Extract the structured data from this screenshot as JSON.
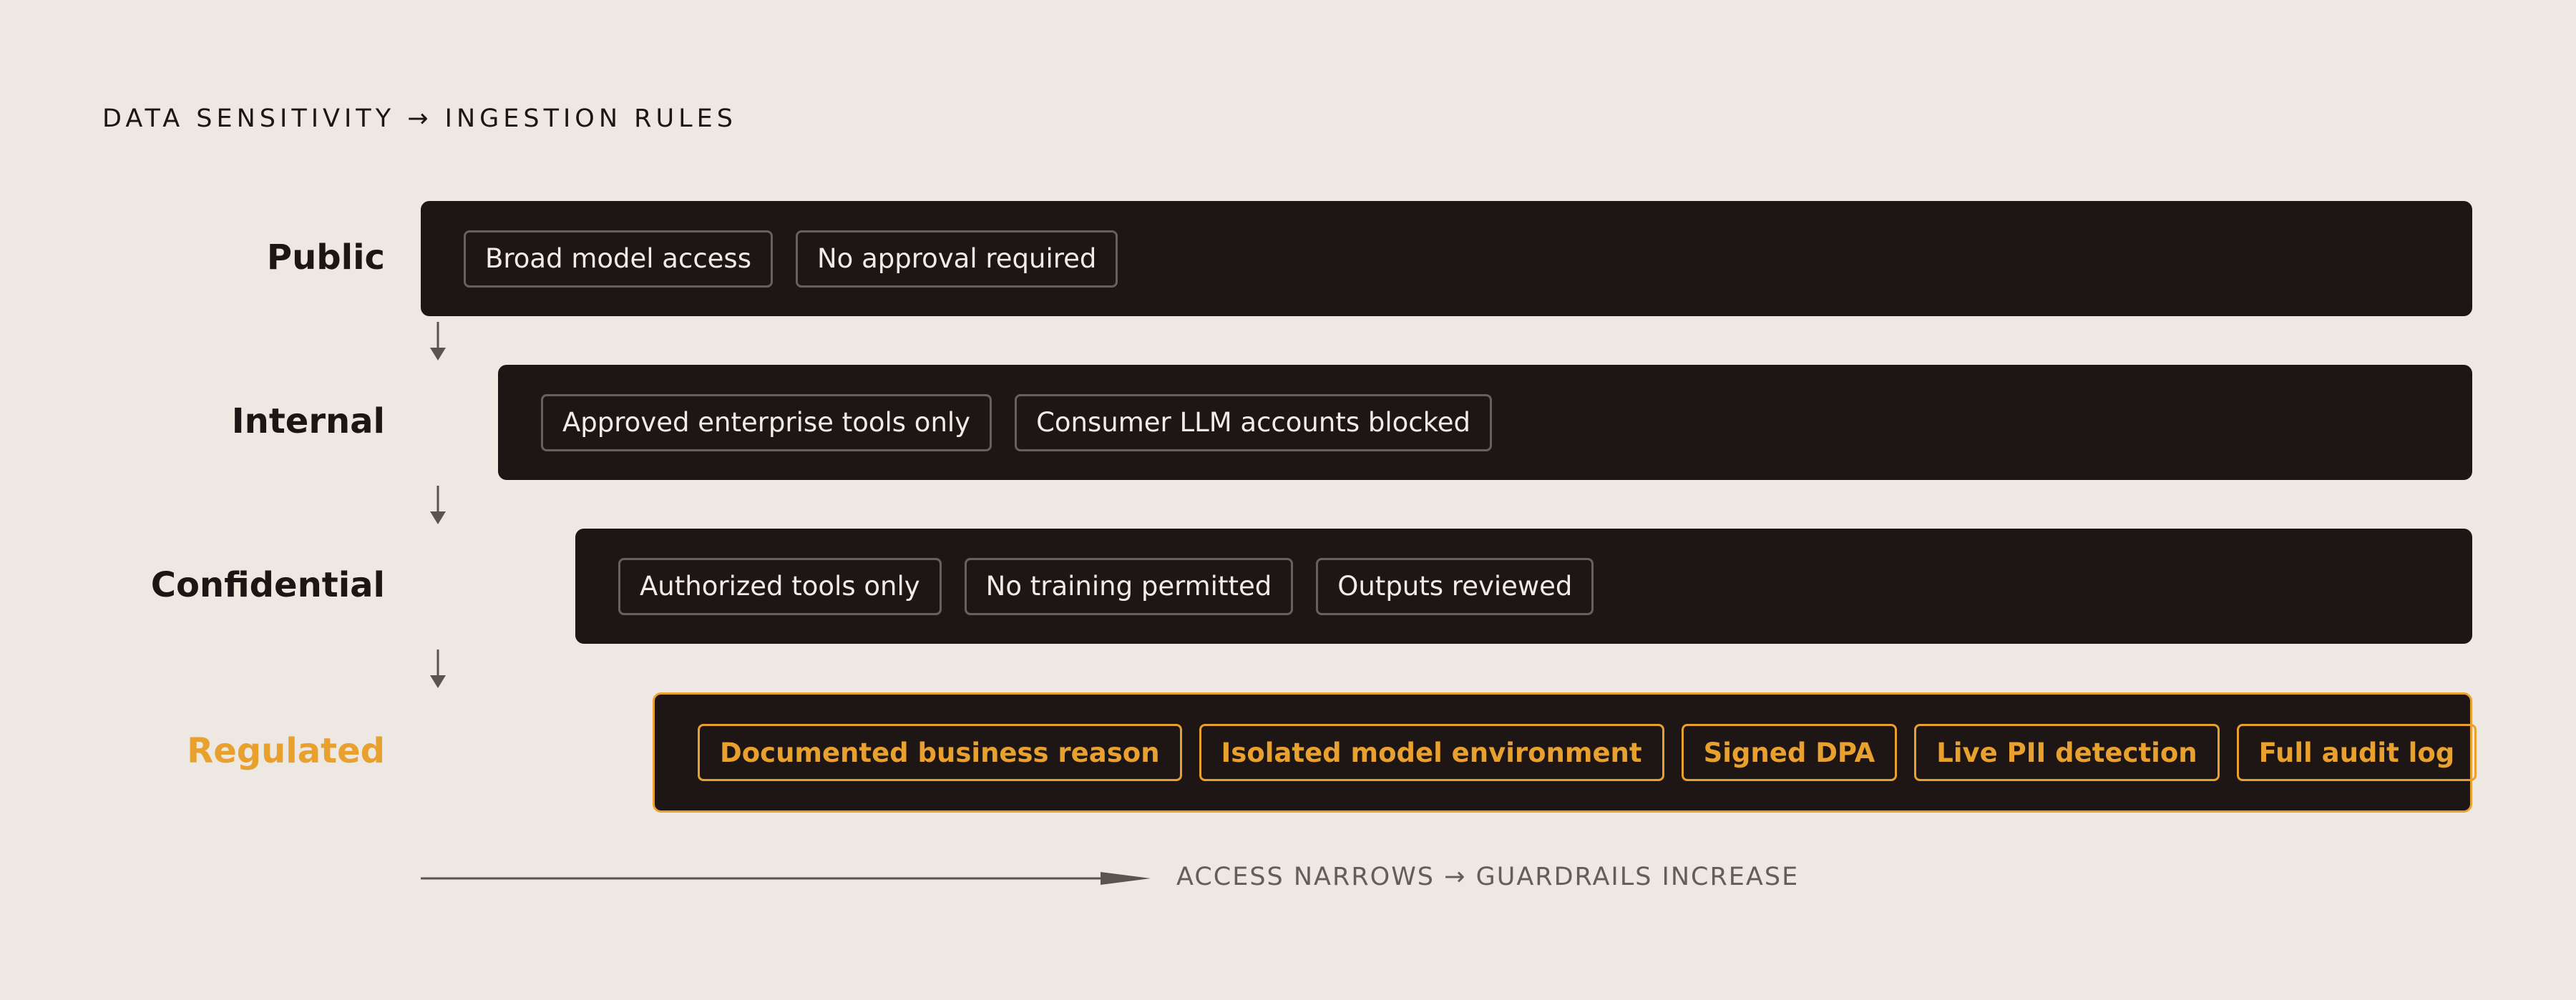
{
  "title": "DATA SENSITIVITY → INGESTION RULES",
  "accent_color": "#e8a02e",
  "tiers": [
    {
      "label": "Public",
      "rules": [
        "Broad model access",
        "No approval required"
      ]
    },
    {
      "label": "Internal",
      "rules": [
        "Approved enterprise tools only",
        "Consumer LLM accounts blocked"
      ]
    },
    {
      "label": "Confidential",
      "rules": [
        "Authorized tools only",
        "No training permitted",
        "Outputs reviewed"
      ]
    },
    {
      "label": "Regulated",
      "rules": [
        "Documented business reason",
        "Isolated model environment",
        "Signed DPA",
        "Live PII detection",
        "Full audit log"
      ]
    }
  ],
  "footer": {
    "text": "ACCESS NARROWS → GUARDRAILS INCREASE"
  },
  "icons": {
    "flow_arrow": "arrow-down-icon",
    "footer_arrow": "arrow-right-icon"
  }
}
